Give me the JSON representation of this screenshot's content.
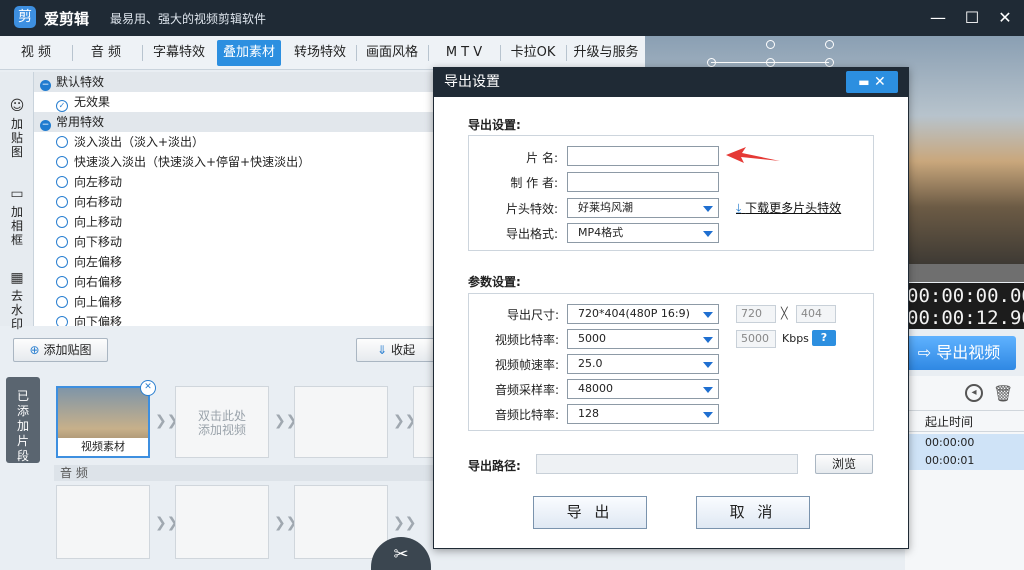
{
  "app": {
    "name": "爱剪辑",
    "slogan": "最易用、强大的视频剪辑软件",
    "logo_char": "剪"
  },
  "window_controls": {
    "minimize": "—",
    "maximize": "☐",
    "close": "✕"
  },
  "tabs": [
    {
      "label": "视  频"
    },
    {
      "label": "音  频"
    },
    {
      "label": "字幕特效"
    },
    {
      "label": "叠加素材",
      "active": true
    },
    {
      "label": "转场特效"
    },
    {
      "label": "画面风格"
    },
    {
      "label": "M T V"
    },
    {
      "label": "卡拉OK"
    },
    {
      "label": "升级与服务"
    }
  ],
  "side_tabs": [
    {
      "label": "加\n贴\n图",
      "icon": "sticker-icon"
    },
    {
      "label": "加\n相\n框",
      "icon": "frame-icon"
    },
    {
      "label": "去\n水\n印",
      "icon": "watermark-icon"
    }
  ],
  "effects": {
    "group_default": "默认特效",
    "default_item": "无效果",
    "group_common": "常用特效",
    "items": [
      "淡入淡出（淡入+淡出）",
      "快速淡入淡出（快速淡入+停留+快速淡出）",
      "向左移动",
      "向右移动",
      "向上移动",
      "向下移动",
      "向左偏移",
      "向右偏移",
      "向上偏移",
      "向下偏移"
    ]
  },
  "toolbar": {
    "add_sticker": "添加贴图",
    "collapse": "收起"
  },
  "clips": {
    "added_tab": "已\n添\n加\n片\n段",
    "first_clip": "视频素材",
    "placeholder": "双击此处\n添加视频",
    "audio_label": "音  频"
  },
  "preview": {
    "time_current": "00:00:00.000",
    "time_total": "00:00:12.900",
    "export_video": "导出视频",
    "list_header": "起止时间",
    "list_rows": [
      "00:00:00",
      "00:00:01"
    ]
  },
  "dialog": {
    "title": "导出设置",
    "close_icon": "✕",
    "section_export": "导出设置:",
    "name_label": "片    名:",
    "name_value": "",
    "author_label": "制 作 者:",
    "author_value": "",
    "intro_label": "片头特效:",
    "intro_value": "好莱坞风潮",
    "download_link": "下载更多片头特效",
    "format_label": "导出格式:",
    "format_value": "MP4格式",
    "section_params": "参数设置:",
    "size_label": "导出尺寸:",
    "size_value": "720*404(480P 16:9)",
    "width_value": "720",
    "times": "╳",
    "height_value": "404",
    "vbitrate_label": "视频比特率:",
    "vbitrate_value": "5000",
    "vbitrate_readonly": "5000",
    "kbps": "Kbps",
    "help": "?",
    "fps_label": "视频帧速率:",
    "fps_value": "25.0",
    "samplerate_label": "音频采样率:",
    "samplerate_value": "48000",
    "abitrate_label": "音频比特率:",
    "abitrate_value": "128",
    "path_label": "导出路径:",
    "path_value": "",
    "browse": "浏览",
    "export_button": "导 出",
    "cancel_button": "取 消"
  },
  "colors": {
    "titlebar": "#1f2a35",
    "accent": "#2c8fe0",
    "annotation": "#e53935"
  }
}
